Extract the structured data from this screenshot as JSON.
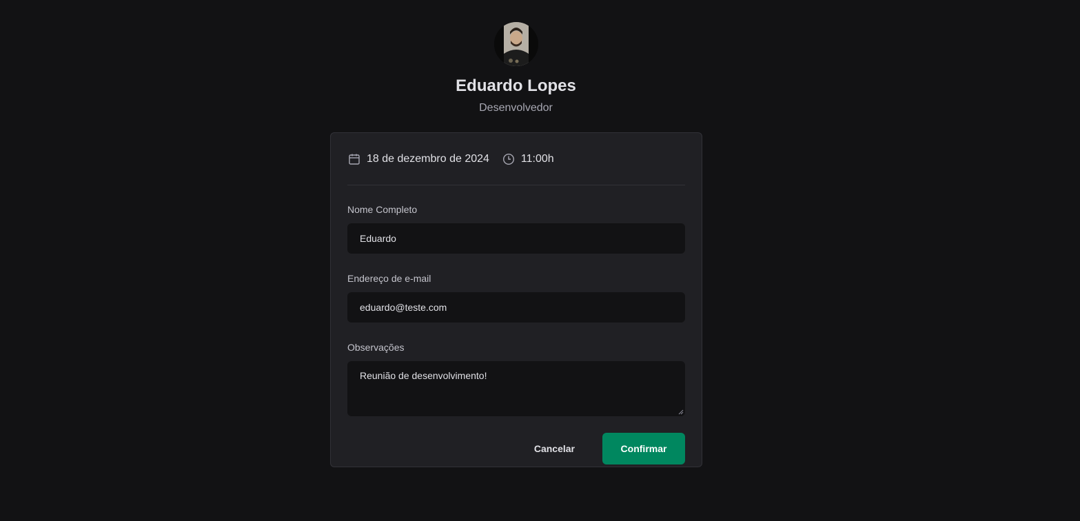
{
  "profile": {
    "name": "Eduardo Lopes",
    "role": "Desenvolvedor",
    "avatar_icon": "user-photo"
  },
  "schedule": {
    "date": "18 de dezembro de 2024",
    "date_icon": "calendar-icon",
    "time": "11:00h",
    "time_icon": "clock-icon"
  },
  "form": {
    "name_label": "Nome Completo",
    "name_value": "Eduardo",
    "email_label": "Endereço de e-mail",
    "email_value": "eduardo@teste.com",
    "notes_label": "Observações",
    "notes_value": "Reunião de desenvolvimento!"
  },
  "actions": {
    "cancel_label": "Cancelar",
    "confirm_label": "Confirmar"
  },
  "colors": {
    "background": "#121214",
    "card": "#202024",
    "input": "#121214",
    "accent": "#00875f",
    "text": "#e1e1e6",
    "muted": "#a8a8b3"
  }
}
